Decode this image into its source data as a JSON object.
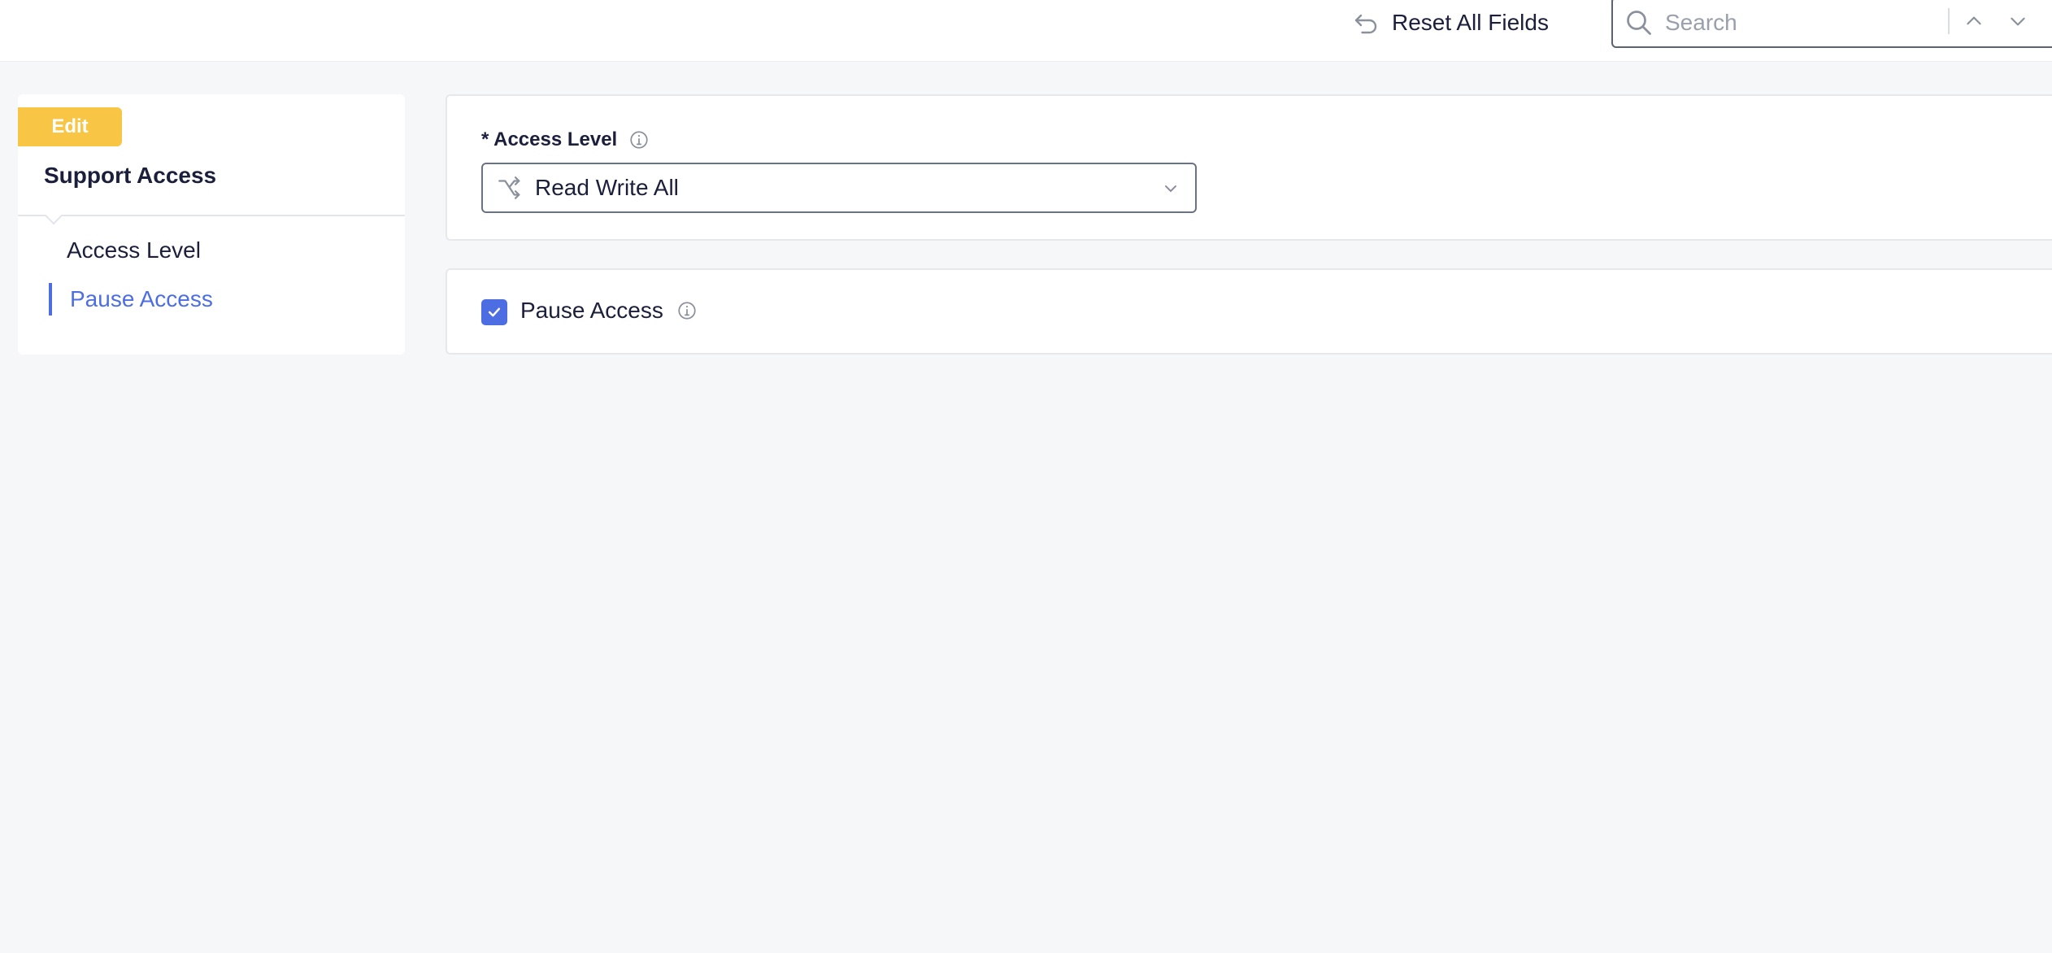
{
  "toolbar": {
    "reset_label": "Reset All Fields",
    "reset_icon": "return-arrow-icon",
    "search_placeholder": "Search",
    "search_icon": "search-icon"
  },
  "sidebar": {
    "badge": "Edit",
    "title": "Support Access",
    "items": [
      {
        "label": "Access Level",
        "active": false
      },
      {
        "label": "Pause Access",
        "active": true
      }
    ]
  },
  "access_level": {
    "label": "* Access Level",
    "selected": "Read Write All",
    "icon": "shuffle-icon"
  },
  "pause_access": {
    "label": "Pause Access",
    "checked": true
  },
  "colors": {
    "accent": "#4d6ee3",
    "badge": "#f8c544",
    "background": "#f6f7f9"
  }
}
